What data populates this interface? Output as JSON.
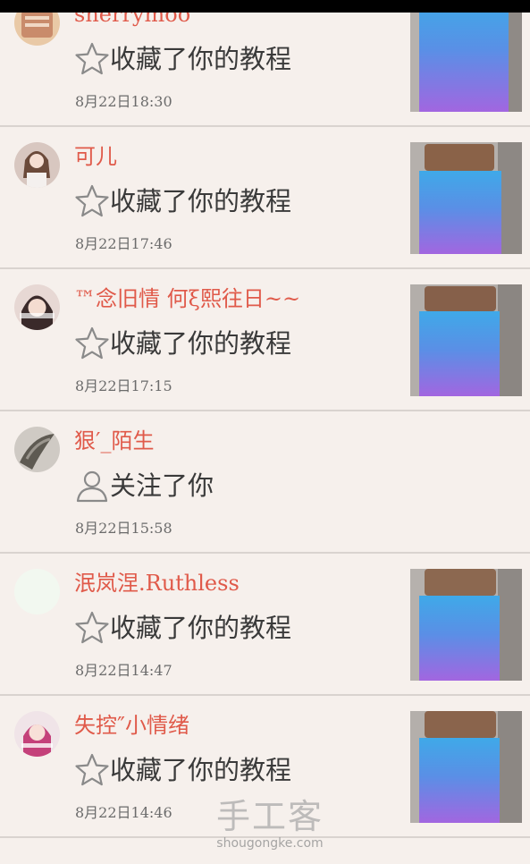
{
  "colors": {
    "background": "#f6f0ec",
    "username": "#e05a4a",
    "action_text": "#3a3a3a",
    "time_text": "#6b6b6b",
    "divider": "#d9d3cf"
  },
  "feed": [
    {
      "username": "sherrymoo",
      "action_icon": "star-icon",
      "action": "收藏了你的教程",
      "time": "8月22日18:30",
      "has_thumbnail": true
    },
    {
      "username": "可儿",
      "action_icon": "star-icon",
      "action": "收藏了你的教程",
      "time": "8月22日17:46",
      "has_thumbnail": true
    },
    {
      "username": "™念旧情 何ξ熙往日~~",
      "action_icon": "star-icon",
      "action": "收藏了你的教程",
      "time": "8月22日17:15",
      "has_thumbnail": true
    },
    {
      "username": "狠′_陌生",
      "action_icon": "person-icon",
      "action": "关注了你",
      "time": "8月22日15:58",
      "has_thumbnail": false
    },
    {
      "username": "泯岚涅.Ruthless",
      "action_icon": "star-icon",
      "action": "收藏了你的教程",
      "time": "8月22日14:47",
      "has_thumbnail": true
    },
    {
      "username": "失控″小情绪",
      "action_icon": "star-icon",
      "action": "收藏了你的教程",
      "time": "8月22日14:46",
      "has_thumbnail": true
    }
  ],
  "watermark": {
    "main": "手工客",
    "sub": "shougongke.com"
  }
}
